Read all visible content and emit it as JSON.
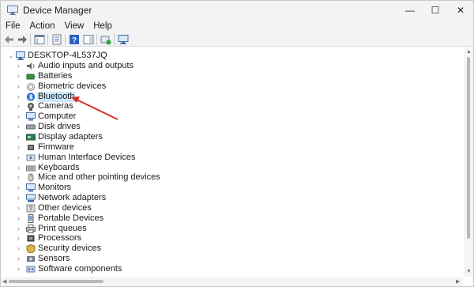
{
  "window": {
    "title": "Device Manager"
  },
  "title_buttons": {
    "minimize": "—",
    "maximize": "☐",
    "close": "✕"
  },
  "menu": [
    "File",
    "Action",
    "View",
    "Help"
  ],
  "tree": {
    "root": "DESKTOP-4L537JQ",
    "categories": [
      {
        "label": "Audio inputs and outputs",
        "icon": "speaker-icon"
      },
      {
        "label": "Batteries",
        "icon": "battery-icon"
      },
      {
        "label": "Biometric devices",
        "icon": "fingerprint-icon"
      },
      {
        "label": "Bluetooth",
        "icon": "bluetooth-icon",
        "selected": true
      },
      {
        "label": "Cameras",
        "icon": "camera-icon"
      },
      {
        "label": "Computer",
        "icon": "monitor-icon"
      },
      {
        "label": "Disk drives",
        "icon": "disk-icon"
      },
      {
        "label": "Display adapters",
        "icon": "display-adapter-icon"
      },
      {
        "label": "Firmware",
        "icon": "chip-icon"
      },
      {
        "label": "Human Interface Devices",
        "icon": "hid-icon"
      },
      {
        "label": "Keyboards",
        "icon": "keyboard-icon"
      },
      {
        "label": "Mice and other pointing devices",
        "icon": "mouse-icon"
      },
      {
        "label": "Monitors",
        "icon": "monitor-icon"
      },
      {
        "label": "Network adapters",
        "icon": "network-icon"
      },
      {
        "label": "Other devices",
        "icon": "unknown-device-icon"
      },
      {
        "label": "Portable Devices",
        "icon": "portable-device-icon"
      },
      {
        "label": "Print queues",
        "icon": "printer-icon"
      },
      {
        "label": "Processors",
        "icon": "processor-icon"
      },
      {
        "label": "Security devices",
        "icon": "security-icon"
      },
      {
        "label": "Sensors",
        "icon": "sensor-icon"
      },
      {
        "label": "Software components",
        "icon": "component-icon"
      }
    ]
  },
  "colors": {
    "selection": "#cde8ff",
    "annotation_arrow": "#d93025"
  }
}
